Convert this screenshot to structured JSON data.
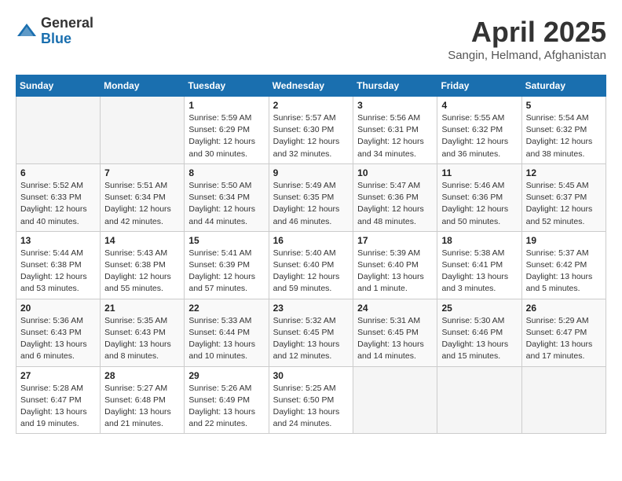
{
  "logo": {
    "general": "General",
    "blue": "Blue"
  },
  "title": "April 2025",
  "subtitle": "Sangin, Helmand, Afghanistan",
  "days_of_week": [
    "Sunday",
    "Monday",
    "Tuesday",
    "Wednesday",
    "Thursday",
    "Friday",
    "Saturday"
  ],
  "weeks": [
    [
      {
        "day": "",
        "info": ""
      },
      {
        "day": "",
        "info": ""
      },
      {
        "day": "1",
        "info": "Sunrise: 5:59 AM\nSunset: 6:29 PM\nDaylight: 12 hours and 30 minutes."
      },
      {
        "day": "2",
        "info": "Sunrise: 5:57 AM\nSunset: 6:30 PM\nDaylight: 12 hours and 32 minutes."
      },
      {
        "day": "3",
        "info": "Sunrise: 5:56 AM\nSunset: 6:31 PM\nDaylight: 12 hours and 34 minutes."
      },
      {
        "day": "4",
        "info": "Sunrise: 5:55 AM\nSunset: 6:32 PM\nDaylight: 12 hours and 36 minutes."
      },
      {
        "day": "5",
        "info": "Sunrise: 5:54 AM\nSunset: 6:32 PM\nDaylight: 12 hours and 38 minutes."
      }
    ],
    [
      {
        "day": "6",
        "info": "Sunrise: 5:52 AM\nSunset: 6:33 PM\nDaylight: 12 hours and 40 minutes."
      },
      {
        "day": "7",
        "info": "Sunrise: 5:51 AM\nSunset: 6:34 PM\nDaylight: 12 hours and 42 minutes."
      },
      {
        "day": "8",
        "info": "Sunrise: 5:50 AM\nSunset: 6:34 PM\nDaylight: 12 hours and 44 minutes."
      },
      {
        "day": "9",
        "info": "Sunrise: 5:49 AM\nSunset: 6:35 PM\nDaylight: 12 hours and 46 minutes."
      },
      {
        "day": "10",
        "info": "Sunrise: 5:47 AM\nSunset: 6:36 PM\nDaylight: 12 hours and 48 minutes."
      },
      {
        "day": "11",
        "info": "Sunrise: 5:46 AM\nSunset: 6:36 PM\nDaylight: 12 hours and 50 minutes."
      },
      {
        "day": "12",
        "info": "Sunrise: 5:45 AM\nSunset: 6:37 PM\nDaylight: 12 hours and 52 minutes."
      }
    ],
    [
      {
        "day": "13",
        "info": "Sunrise: 5:44 AM\nSunset: 6:38 PM\nDaylight: 12 hours and 53 minutes."
      },
      {
        "day": "14",
        "info": "Sunrise: 5:43 AM\nSunset: 6:38 PM\nDaylight: 12 hours and 55 minutes."
      },
      {
        "day": "15",
        "info": "Sunrise: 5:41 AM\nSunset: 6:39 PM\nDaylight: 12 hours and 57 minutes."
      },
      {
        "day": "16",
        "info": "Sunrise: 5:40 AM\nSunset: 6:40 PM\nDaylight: 12 hours and 59 minutes."
      },
      {
        "day": "17",
        "info": "Sunrise: 5:39 AM\nSunset: 6:40 PM\nDaylight: 13 hours and 1 minute."
      },
      {
        "day": "18",
        "info": "Sunrise: 5:38 AM\nSunset: 6:41 PM\nDaylight: 13 hours and 3 minutes."
      },
      {
        "day": "19",
        "info": "Sunrise: 5:37 AM\nSunset: 6:42 PM\nDaylight: 13 hours and 5 minutes."
      }
    ],
    [
      {
        "day": "20",
        "info": "Sunrise: 5:36 AM\nSunset: 6:43 PM\nDaylight: 13 hours and 6 minutes."
      },
      {
        "day": "21",
        "info": "Sunrise: 5:35 AM\nSunset: 6:43 PM\nDaylight: 13 hours and 8 minutes."
      },
      {
        "day": "22",
        "info": "Sunrise: 5:33 AM\nSunset: 6:44 PM\nDaylight: 13 hours and 10 minutes."
      },
      {
        "day": "23",
        "info": "Sunrise: 5:32 AM\nSunset: 6:45 PM\nDaylight: 13 hours and 12 minutes."
      },
      {
        "day": "24",
        "info": "Sunrise: 5:31 AM\nSunset: 6:45 PM\nDaylight: 13 hours and 14 minutes."
      },
      {
        "day": "25",
        "info": "Sunrise: 5:30 AM\nSunset: 6:46 PM\nDaylight: 13 hours and 15 minutes."
      },
      {
        "day": "26",
        "info": "Sunrise: 5:29 AM\nSunset: 6:47 PM\nDaylight: 13 hours and 17 minutes."
      }
    ],
    [
      {
        "day": "27",
        "info": "Sunrise: 5:28 AM\nSunset: 6:47 PM\nDaylight: 13 hours and 19 minutes."
      },
      {
        "day": "28",
        "info": "Sunrise: 5:27 AM\nSunset: 6:48 PM\nDaylight: 13 hours and 21 minutes."
      },
      {
        "day": "29",
        "info": "Sunrise: 5:26 AM\nSunset: 6:49 PM\nDaylight: 13 hours and 22 minutes."
      },
      {
        "day": "30",
        "info": "Sunrise: 5:25 AM\nSunset: 6:50 PM\nDaylight: 13 hours and 24 minutes."
      },
      {
        "day": "",
        "info": ""
      },
      {
        "day": "",
        "info": ""
      },
      {
        "day": "",
        "info": ""
      }
    ]
  ]
}
